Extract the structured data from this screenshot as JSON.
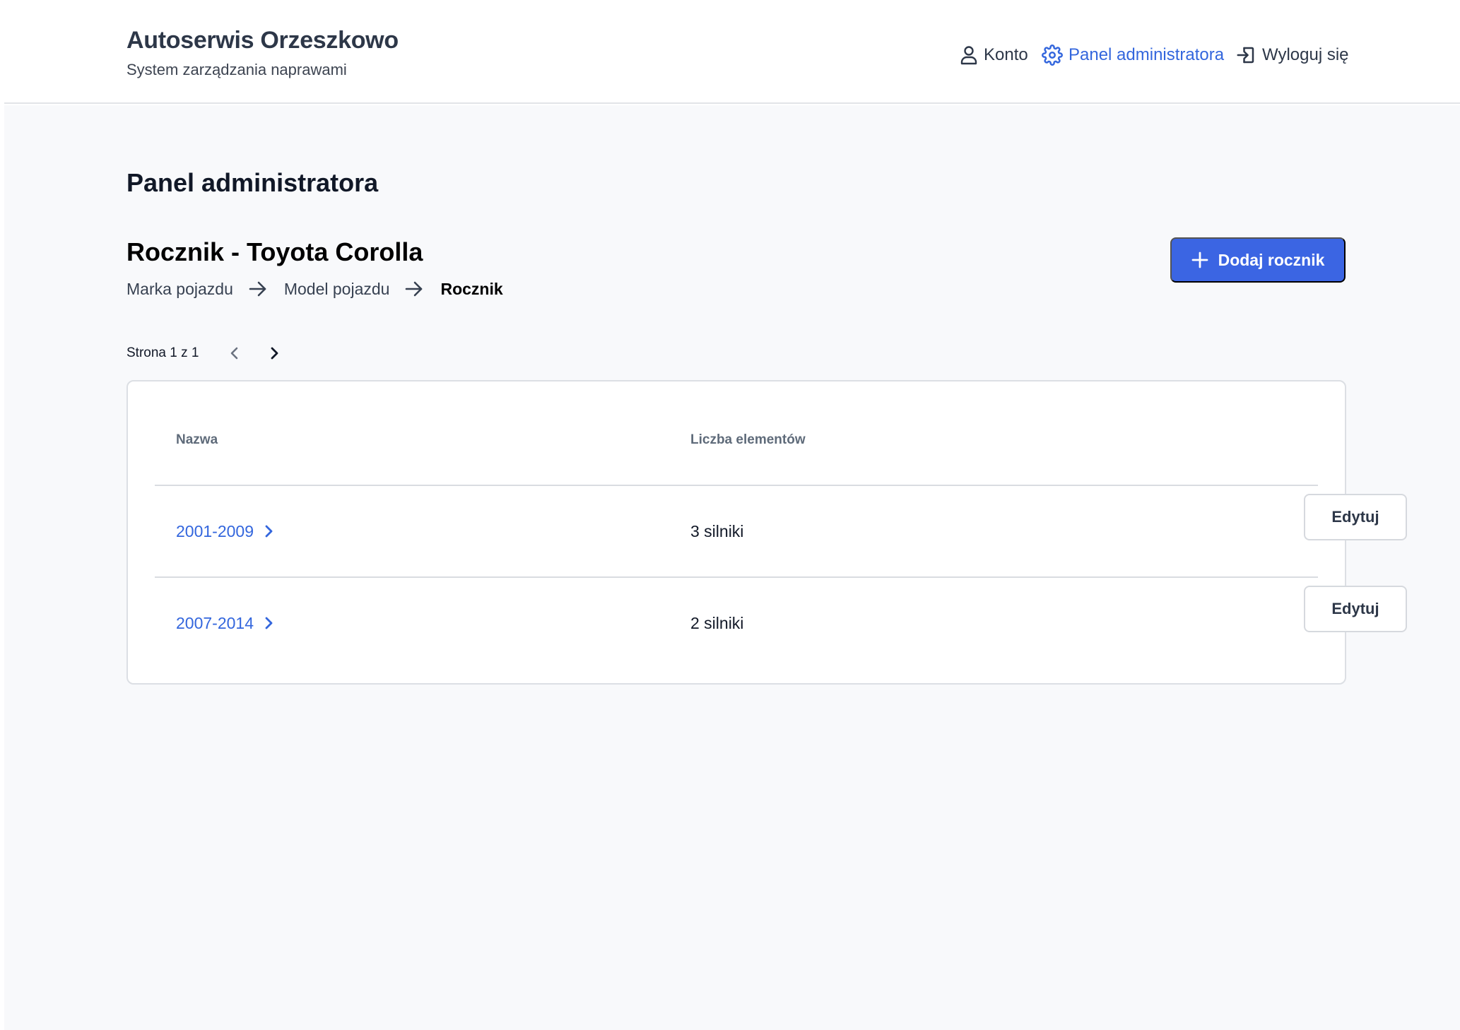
{
  "header": {
    "brand_title": "Autoserwis Orzeszkowo",
    "brand_subtitle": "System zarządzania naprawami",
    "nav": {
      "account": "Konto",
      "admin": "Panel administratora",
      "logout": "Wyloguj się"
    }
  },
  "main": {
    "page_title": "Panel administratora",
    "section_title": "Rocznik - Toyota Corolla",
    "breadcrumb": [
      "Marka pojazdu",
      "Model pojazdu",
      "Rocznik"
    ],
    "add_button": "Dodaj rocznik",
    "pager": {
      "label": "Strona 1 z 1"
    },
    "table": {
      "columns": [
        "Nazwa",
        "Liczba elementów"
      ],
      "rows": [
        {
          "name": "2001-2009",
          "count": "3 silniki",
          "action": "Edytuj"
        },
        {
          "name": "2007-2014",
          "count": "2 silniki",
          "action": "Edytuj"
        }
      ]
    }
  },
  "colors": {
    "accent": "#3b65e3",
    "link": "#3366dd",
    "background": "#f8f9fb"
  },
  "icons": {
    "account": "user-icon",
    "admin": "gear-icon",
    "logout": "logout-icon",
    "breadcrumb_separator": "arrow-right-icon",
    "add": "plus-icon",
    "prev": "chevron-left-icon",
    "next": "chevron-right-icon",
    "row_link": "chevron-right-icon"
  }
}
